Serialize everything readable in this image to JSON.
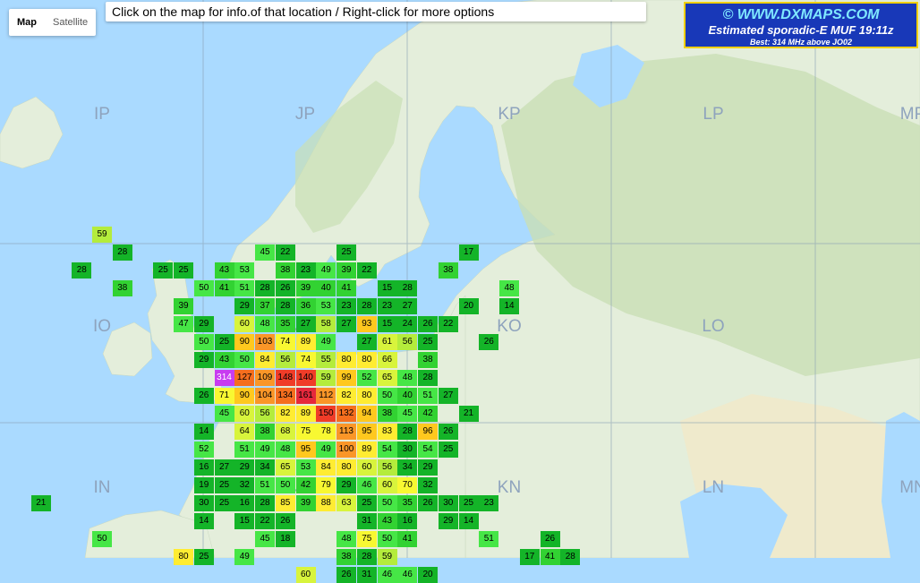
{
  "map_type": {
    "map": "Map",
    "satellite": "Satellite"
  },
  "info_bar": "Click on the map for info.of that location / Right-click for more options",
  "branding": {
    "line1": "© WWW.DXMAPS.COM",
    "line2": "Estimated sporadic-E MUF 19:11z",
    "line3": "Best: 314 MHz above JO02"
  },
  "grid_labels": [
    "IP",
    "JP",
    "KP",
    "LP",
    "MP",
    "IO",
    "JO",
    "KO",
    "LO",
    "IN",
    "JN",
    "KN",
    "LN",
    "MN"
  ],
  "muf_rows": [
    {
      "row": 0,
      "cells": [
        [
          4,
          59
        ]
      ]
    },
    {
      "row": 1,
      "cells": [
        [
          5,
          28
        ],
        [
          12,
          45
        ],
        [
          13,
          22
        ],
        [
          16,
          25
        ],
        [
          22,
          17
        ]
      ]
    },
    {
      "row": 2,
      "cells": [
        [
          3,
          28
        ],
        [
          7,
          25
        ],
        [
          8,
          25
        ],
        [
          10,
          43
        ],
        [
          11,
          53
        ],
        [
          13,
          38
        ],
        [
          14,
          23
        ],
        [
          15,
          49
        ],
        [
          16,
          39
        ],
        [
          17,
          22
        ],
        [
          21,
          38
        ]
      ]
    },
    {
      "row": 3,
      "cells": [
        [
          5,
          38
        ],
        [
          9,
          50
        ],
        [
          10,
          41
        ],
        [
          11,
          51
        ],
        [
          12,
          28
        ],
        [
          13,
          26
        ],
        [
          14,
          39
        ],
        [
          15,
          40
        ],
        [
          16,
          41
        ],
        [
          18,
          15
        ],
        [
          19,
          28
        ],
        [
          24,
          48
        ]
      ]
    },
    {
      "row": 4,
      "cells": [
        [
          8,
          39
        ],
        [
          11,
          29
        ],
        [
          12,
          37
        ],
        [
          13,
          28
        ],
        [
          14,
          36
        ],
        [
          15,
          53
        ],
        [
          16,
          23
        ],
        [
          17,
          28
        ],
        [
          18,
          23
        ],
        [
          19,
          27
        ],
        [
          22,
          20
        ],
        [
          24,
          14
        ]
      ]
    },
    {
      "row": 5,
      "cells": [
        [
          8,
          47
        ],
        [
          9,
          29
        ],
        [
          11,
          60
        ],
        [
          12,
          48
        ],
        [
          13,
          35
        ],
        [
          14,
          27
        ],
        [
          15,
          58
        ],
        [
          16,
          27
        ],
        [
          17,
          93
        ],
        [
          18,
          15
        ],
        [
          19,
          24
        ],
        [
          20,
          26
        ],
        [
          21,
          22
        ]
      ]
    },
    {
      "row": 6,
      "cells": [
        [
          9,
          50
        ],
        [
          10,
          25
        ],
        [
          11,
          90
        ],
        [
          12,
          103
        ],
        [
          13,
          74
        ],
        [
          14,
          89
        ],
        [
          15,
          49
        ],
        [
          17,
          27
        ],
        [
          18,
          61
        ],
        [
          19,
          56
        ],
        [
          20,
          25
        ],
        [
          23,
          26
        ]
      ]
    },
    {
      "row": 7,
      "cells": [
        [
          9,
          29
        ],
        [
          10,
          43
        ],
        [
          11,
          50
        ],
        [
          12,
          84
        ],
        [
          13,
          56
        ],
        [
          14,
          74
        ],
        [
          15,
          55
        ],
        [
          16,
          80
        ],
        [
          17,
          80
        ],
        [
          18,
          66
        ],
        [
          20,
          38
        ]
      ]
    },
    {
      "row": 8,
      "cells": [
        [
          10,
          314
        ],
        [
          11,
          127
        ],
        [
          12,
          109
        ],
        [
          13,
          148
        ],
        [
          14,
          140
        ],
        [
          15,
          59
        ],
        [
          16,
          99
        ],
        [
          17,
          52
        ],
        [
          18,
          65
        ],
        [
          19,
          48
        ],
        [
          20,
          28
        ]
      ]
    },
    {
      "row": 9,
      "cells": [
        [
          9,
          26
        ],
        [
          10,
          71
        ],
        [
          11,
          90
        ],
        [
          12,
          104
        ],
        [
          13,
          134
        ],
        [
          14,
          161
        ],
        [
          15,
          112
        ],
        [
          16,
          82
        ],
        [
          17,
          80
        ],
        [
          18,
          50
        ],
        [
          19,
          40
        ],
        [
          20,
          51
        ],
        [
          21,
          27
        ]
      ]
    },
    {
      "row": 10,
      "cells": [
        [
          10,
          45
        ],
        [
          11,
          60
        ],
        [
          12,
          56
        ],
        [
          13,
          82
        ],
        [
          14,
          89
        ],
        [
          15,
          150
        ],
        [
          16,
          132
        ],
        [
          17,
          94
        ],
        [
          18,
          38
        ],
        [
          19,
          45
        ],
        [
          20,
          42
        ],
        [
          22,
          21
        ]
      ]
    },
    {
      "row": 11,
      "cells": [
        [
          9,
          14
        ],
        [
          11,
          64
        ],
        [
          12,
          38
        ],
        [
          13,
          68
        ],
        [
          14,
          75
        ],
        [
          15,
          78
        ],
        [
          16,
          113
        ],
        [
          17,
          95
        ],
        [
          18,
          83
        ],
        [
          19,
          28
        ],
        [
          20,
          96
        ],
        [
          21,
          26
        ]
      ]
    },
    {
      "row": 12,
      "cells": [
        [
          9,
          52
        ],
        [
          11,
          51
        ],
        [
          12,
          49
        ],
        [
          13,
          48
        ],
        [
          14,
          95
        ],
        [
          15,
          49
        ],
        [
          16,
          100
        ],
        [
          17,
          89
        ],
        [
          18,
          54
        ],
        [
          19,
          30
        ],
        [
          20,
          54
        ],
        [
          21,
          25
        ]
      ]
    },
    {
      "row": 13,
      "cells": [
        [
          9,
          16
        ],
        [
          10,
          27
        ],
        [
          11,
          29
        ],
        [
          12,
          34
        ],
        [
          13,
          65
        ],
        [
          14,
          53
        ],
        [
          15,
          84
        ],
        [
          16,
          80
        ],
        [
          17,
          60
        ],
        [
          18,
          56
        ],
        [
          19,
          34
        ],
        [
          20,
          29
        ]
      ]
    },
    {
      "row": 14,
      "cells": [
        [
          9,
          19
        ],
        [
          10,
          25
        ],
        [
          11,
          32
        ],
        [
          12,
          51
        ],
        [
          13,
          50
        ],
        [
          14,
          42
        ],
        [
          15,
          79
        ],
        [
          16,
          29
        ],
        [
          17,
          46
        ],
        [
          18,
          60
        ],
        [
          19,
          70
        ],
        [
          20,
          32
        ]
      ]
    },
    {
      "row": 15,
      "cells": [
        [
          1,
          21
        ],
        [
          9,
          30
        ],
        [
          10,
          25
        ],
        [
          11,
          16
        ],
        [
          12,
          28
        ],
        [
          13,
          85
        ],
        [
          14,
          39
        ],
        [
          15,
          88
        ],
        [
          16,
          63
        ],
        [
          17,
          25
        ],
        [
          18,
          50
        ],
        [
          19,
          35
        ],
        [
          20,
          26
        ],
        [
          21,
          30
        ],
        [
          22,
          25
        ],
        [
          23,
          23
        ]
      ]
    },
    {
      "row": 16,
      "cells": [
        [
          9,
          14
        ],
        [
          11,
          15
        ],
        [
          12,
          22
        ],
        [
          13,
          26
        ],
        [
          17,
          31
        ],
        [
          18,
          43
        ],
        [
          19,
          16
        ],
        [
          21,
          29
        ],
        [
          22,
          14
        ]
      ]
    },
    {
      "row": 17,
      "cells": [
        [
          4,
          50
        ],
        [
          12,
          45
        ],
        [
          13,
          18
        ],
        [
          16,
          48
        ],
        [
          17,
          75
        ],
        [
          18,
          50
        ],
        [
          19,
          41
        ],
        [
          23,
          51
        ],
        [
          26,
          26
        ]
      ]
    },
    {
      "row": 18,
      "cells": [
        [
          8,
          80
        ],
        [
          9,
          25
        ],
        [
          11,
          49
        ],
        [
          16,
          38
        ],
        [
          17,
          28
        ],
        [
          18,
          59
        ],
        [
          25,
          17
        ],
        [
          26,
          41
        ],
        [
          27,
          28
        ]
      ]
    },
    {
      "row": 19,
      "cells": [
        [
          14,
          60
        ],
        [
          16,
          26
        ],
        [
          17,
          31
        ],
        [
          18,
          46
        ],
        [
          19,
          46
        ],
        [
          20,
          20
        ]
      ]
    }
  ],
  "colors": {
    "sea": "#aadaff",
    "land": "#e4eedb",
    "forest": "#c9dfb5",
    "grid_line": "#8aa0b4",
    "label": "#8ea3bd",
    "brand_bg": "#1838b8",
    "brand_border": "#f0d000"
  }
}
